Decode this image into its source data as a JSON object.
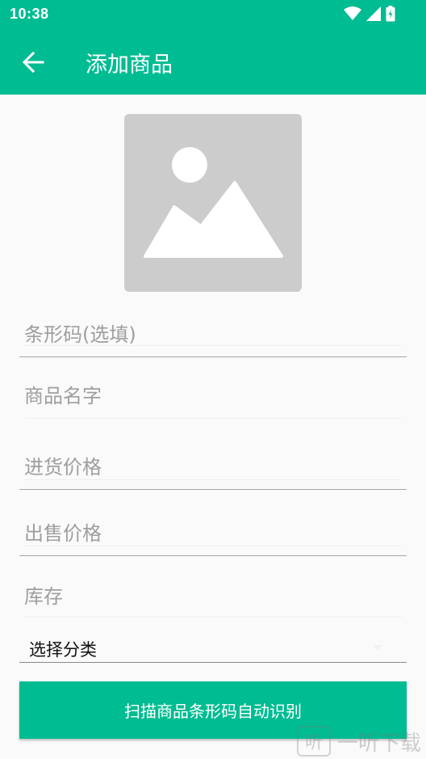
{
  "status_bar": {
    "time": "10:38"
  },
  "app_bar": {
    "title": "添加商品"
  },
  "form": {
    "barcode_placeholder": "条形码(选填)",
    "name_placeholder": "商品名字",
    "purchase_price_placeholder": "进货价格",
    "sale_price_placeholder": "出售价格",
    "stock_placeholder": "库存",
    "category_selected": "选择分类"
  },
  "actions": {
    "scan_button_label": "扫描商品条形码自动识别"
  },
  "watermark": {
    "logo_text": "听",
    "text": "一听下载"
  },
  "colors": {
    "primary": "#00bc92",
    "placeholder": "#cccccc"
  }
}
